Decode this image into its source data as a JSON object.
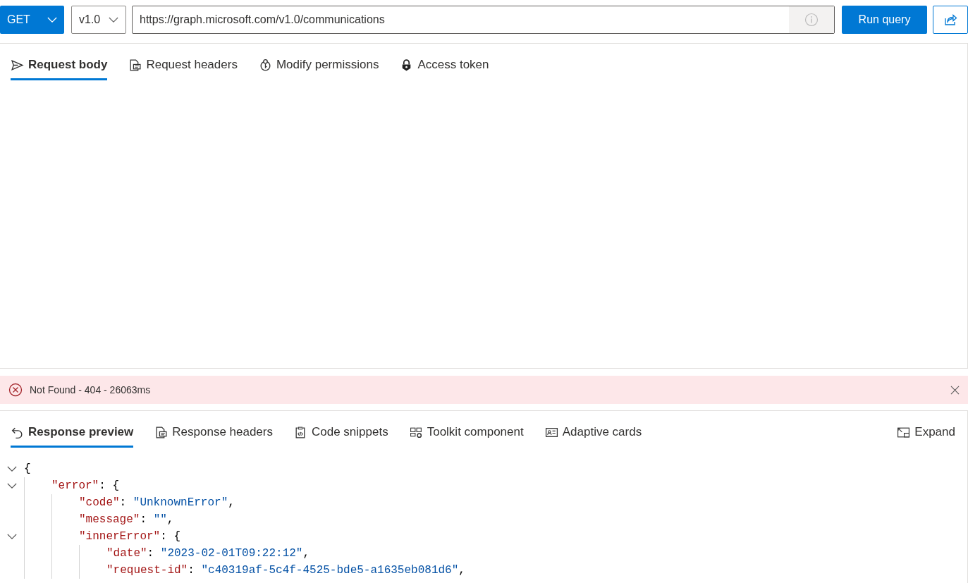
{
  "query_bar": {
    "method": "GET",
    "version": "v1.0",
    "url": "https://graph.microsoft.com/v1.0/communications",
    "run_button": "Run query"
  },
  "request_tabs": [
    {
      "label": "Request body",
      "selected": true
    },
    {
      "label": "Request headers",
      "selected": false
    },
    {
      "label": "Modify permissions",
      "selected": false
    },
    {
      "label": "Access token",
      "selected": false
    }
  ],
  "status": {
    "kind": "error",
    "message": "Not Found - 404 - 26063ms"
  },
  "response_tabs": [
    {
      "label": "Response preview",
      "selected": true
    },
    {
      "label": "Response headers",
      "selected": false
    },
    {
      "label": "Code snippets",
      "selected": false
    },
    {
      "label": "Toolkit component",
      "selected": false
    },
    {
      "label": "Adaptive cards",
      "selected": false
    }
  ],
  "expand_button": "Expand",
  "response_code": [
    {
      "tokens": [
        {
          "kind": "punct",
          "text": "{"
        }
      ],
      "children": [
        {
          "tokens": [
            {
              "kind": "key",
              "text": "\"error\""
            },
            {
              "kind": "punct",
              "text": ": {"
            }
          ],
          "children": [
            {
              "tokens": [
                {
                  "kind": "key",
                  "text": "\"code\""
                },
                {
                  "kind": "punct",
                  "text": ": "
                },
                {
                  "kind": "string",
                  "text": "\"UnknownError\""
                },
                {
                  "kind": "punct",
                  "text": ","
                }
              ]
            },
            {
              "tokens": [
                {
                  "kind": "key",
                  "text": "\"message\""
                },
                {
                  "kind": "punct",
                  "text": ": "
                },
                {
                  "kind": "string",
                  "text": "\"\""
                },
                {
                  "kind": "punct",
                  "text": ","
                }
              ]
            },
            {
              "tokens": [
                {
                  "kind": "key",
                  "text": "\"innerError\""
                },
                {
                  "kind": "punct",
                  "text": ": {"
                }
              ],
              "children": [
                {
                  "tokens": [
                    {
                      "kind": "key",
                      "text": "\"date\""
                    },
                    {
                      "kind": "punct",
                      "text": ": "
                    },
                    {
                      "kind": "string",
                      "text": "\"2023-02-01T09:22:12\""
                    },
                    {
                      "kind": "punct",
                      "text": ","
                    }
                  ]
                },
                {
                  "tokens": [
                    {
                      "kind": "key",
                      "text": "\"request-id\""
                    },
                    {
                      "kind": "punct",
                      "text": ": "
                    },
                    {
                      "kind": "string",
                      "text": "\"c40319af-5c4f-4525-bde5-a1635eb081d6\""
                    },
                    {
                      "kind": "punct",
                      "text": ","
                    }
                  ]
                }
              ]
            }
          ]
        }
      ]
    }
  ]
}
